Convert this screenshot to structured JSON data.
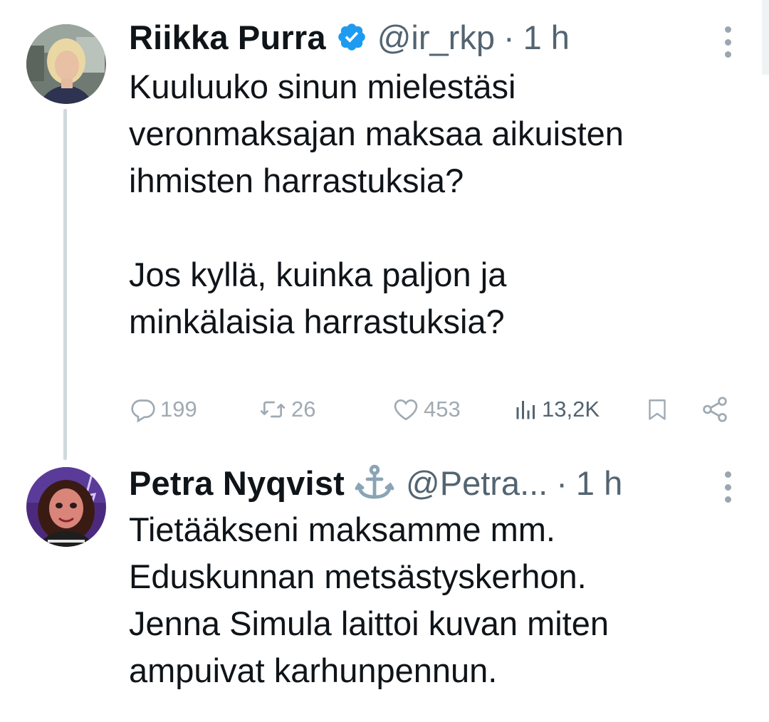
{
  "tweets": [
    {
      "author": {
        "display_name": "Riikka Purra",
        "handle": "@ir_rkp",
        "badge": "verified-badge-icon"
      },
      "separator": "·",
      "time": "1 h",
      "text": "Kuuluuko sinun mielestäsi\nveronmaksajan maksaa aikuisten\nihmisten harrastuksia?\n\nJos kyllä, kuinka paljon ja\nminkälaisia harrastuksia?",
      "stats": {
        "replies": "199",
        "retweets": "26",
        "likes": "453",
        "views": "13,2K"
      }
    },
    {
      "author": {
        "display_name": "Petra Nyqvist",
        "handle": "@Petra...",
        "badge": "anchor-emoji-icon"
      },
      "separator": "·",
      "time": "1 h",
      "text": "Tietääkseni maksamme mm.\nEduskunnan metsästyskerhon.\nJenna Simula laittoi kuvan miten\nampuivat karhunpennun."
    }
  ],
  "colors": {
    "text_primary": "#0f1419",
    "text_secondary": "#536471",
    "verified_blue": "#1d9bf0",
    "thread_line": "#cfd9de",
    "action_icon": "#a0aab3"
  }
}
